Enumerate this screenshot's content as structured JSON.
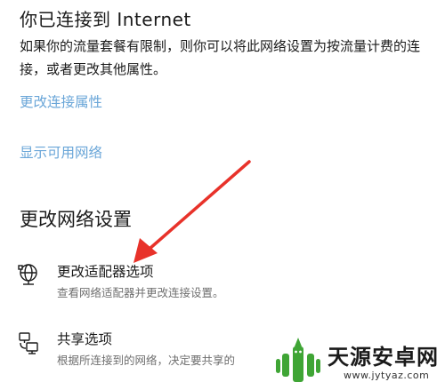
{
  "status": {
    "heading": "你已连接到 Internet",
    "description": "如果你的流量套餐有限制，则你可以将此网络设置为按流量计费的连接，或者更改其他属性。"
  },
  "links": {
    "change_connection_properties": "更改连接属性",
    "show_available_networks": "显示可用网络"
  },
  "section": {
    "title": "更改网络设置"
  },
  "options": [
    {
      "icon": "network-adapter-icon",
      "title": "更改适配器选项",
      "subtitle": "查看网络适配器并更改连接设置。"
    },
    {
      "icon": "sharing-icon",
      "title": "共享选项",
      "subtitle": "根据所连接到的网络，决定要共享的"
    }
  ],
  "annotation": {
    "arrow_color": "#e8322a"
  },
  "watermark": {
    "name": "天源安卓网",
    "url": "www.jytyaz.com",
    "brand_color": "#3fa535"
  },
  "colors": {
    "link": "#6aa6d8",
    "text": "#1a1a1a",
    "subtext": "#6f6f6f"
  }
}
